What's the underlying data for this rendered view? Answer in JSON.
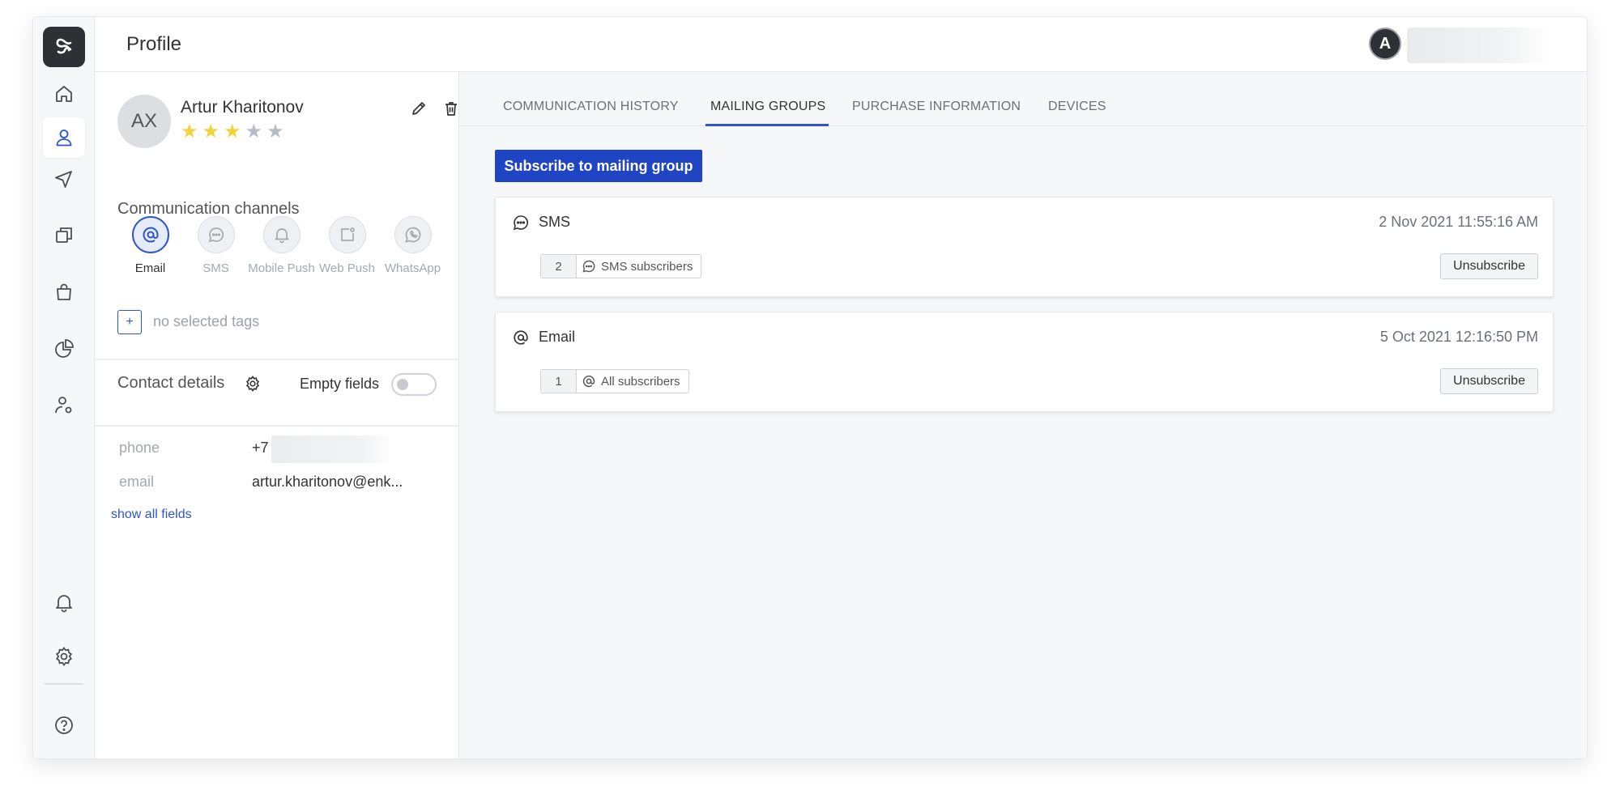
{
  "header": {
    "title": "Profile",
    "user_initial": "A"
  },
  "rail": {
    "items": [
      {
        "name": "home",
        "icon": "home-icon"
      },
      {
        "name": "contacts",
        "icon": "user-icon",
        "active": true
      },
      {
        "name": "campaigns",
        "icon": "send-icon"
      },
      {
        "name": "templates",
        "icon": "copy-icon"
      },
      {
        "name": "purchases",
        "icon": "bag-icon"
      },
      {
        "name": "analytics",
        "icon": "pie-chart-icon"
      },
      {
        "name": "user-settings",
        "icon": "user-settings-icon"
      },
      {
        "name": "notifications",
        "icon": "bell-icon"
      },
      {
        "name": "settings",
        "icon": "gear-icon"
      },
      {
        "name": "help",
        "icon": "help-icon"
      }
    ]
  },
  "profile": {
    "initials": "AX",
    "name": "Artur Kharitonov",
    "rating": 3,
    "rating_max": 5,
    "channels_title": "Communication channels",
    "channels": [
      {
        "label": "Email",
        "icon": "at-icon",
        "active": true
      },
      {
        "label": "SMS",
        "icon": "chat-icon",
        "active": false
      },
      {
        "label": "Mobile Push",
        "icon": "bell-icon",
        "active": false
      },
      {
        "label": "Web Push",
        "icon": "browser-icon",
        "active": false
      },
      {
        "label": "WhatsApp",
        "icon": "whatsapp-icon",
        "active": false
      }
    ],
    "tags_add": "+",
    "tags_text": "no selected tags",
    "contact_title": "Contact details",
    "empty_fields_label": "Empty fields",
    "empty_fields_on": false,
    "fields": [
      {
        "label": "phone",
        "value": "+7"
      },
      {
        "label": "email",
        "value": "artur.kharitonov@enk..."
      }
    ],
    "show_all": "show all fields"
  },
  "tabs": [
    {
      "label": "COMMUNICATION HISTORY",
      "active": false
    },
    {
      "label": "MAILING GROUPS",
      "active": true
    },
    {
      "label": "PURCHASE INFORMATION",
      "active": false
    },
    {
      "label": "DEVICES",
      "active": false
    }
  ],
  "main": {
    "subscribe_button": "Subscribe to mailing group",
    "groups": [
      {
        "channel": "SMS",
        "icon": "chat-icon",
        "date": "2 Nov 2021 11:55:16 AM",
        "count": "2",
        "group_name": "SMS subscribers",
        "action": "Unsubscribe"
      },
      {
        "channel": "Email",
        "icon": "at-icon",
        "date": "5 Oct 2021 12:16:50 PM",
        "count": "1",
        "group_name": "All subscribers",
        "action": "Unsubscribe"
      }
    ]
  },
  "colors": {
    "accent": "#1f44c4",
    "star_on": "#f2d33d",
    "star_off": "#b8bcc4"
  }
}
